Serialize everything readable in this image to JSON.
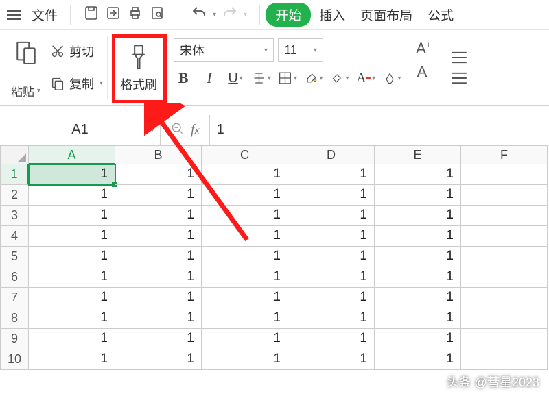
{
  "menu": {
    "file": "文件",
    "start": "开始",
    "insert": "插入",
    "layout": "页面布局",
    "formula": "公式"
  },
  "ribbon": {
    "paste": "粘贴",
    "cut": "剪切",
    "copy": "复制",
    "format_painter": "格式刷",
    "font_name": "宋体",
    "font_size": "11"
  },
  "name_box": "A1",
  "formula_value": "1",
  "columns": [
    "A",
    "B",
    "C",
    "D",
    "E",
    "F"
  ],
  "rows": [
    {
      "n": "1",
      "v": [
        "1",
        "1",
        "1",
        "1",
        "1",
        ""
      ]
    },
    {
      "n": "2",
      "v": [
        "1",
        "1",
        "1",
        "1",
        "1",
        ""
      ]
    },
    {
      "n": "3",
      "v": [
        "1",
        "1",
        "1",
        "1",
        "1",
        ""
      ]
    },
    {
      "n": "4",
      "v": [
        "1",
        "1",
        "1",
        "1",
        "1",
        ""
      ]
    },
    {
      "n": "5",
      "v": [
        "1",
        "1",
        "1",
        "1",
        "1",
        ""
      ]
    },
    {
      "n": "6",
      "v": [
        "1",
        "1",
        "1",
        "1",
        "1",
        ""
      ]
    },
    {
      "n": "7",
      "v": [
        "1",
        "1",
        "1",
        "1",
        "1",
        ""
      ]
    },
    {
      "n": "8",
      "v": [
        "1",
        "1",
        "1",
        "1",
        "1",
        ""
      ]
    },
    {
      "n": "9",
      "v": [
        "1",
        "1",
        "1",
        "1",
        "1",
        ""
      ]
    },
    {
      "n": "10",
      "v": [
        "1",
        "1",
        "1",
        "1",
        "1",
        ""
      ]
    }
  ],
  "watermark": "头条 @彗星2023",
  "selected": {
    "r": 0,
    "c": 0
  }
}
